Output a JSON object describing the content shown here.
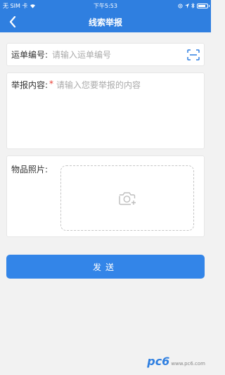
{
  "status_bar": {
    "carrier": "无 SIM 卡",
    "time": "下午5:53",
    "icons": [
      "wifi-icon",
      "lock-rotation-icon",
      "location-icon",
      "bluetooth-icon",
      "battery-icon"
    ]
  },
  "nav": {
    "title": "线索举报",
    "back_icon": "chevron-left-icon"
  },
  "form": {
    "waybill_label": "运单编号:",
    "waybill_placeholder": "请输入运单编号",
    "scan_icon": "scan-icon",
    "content_label": "举报内容:",
    "required_mark": "*",
    "content_placeholder": "请输入您要举报的内容",
    "photo_label": "物品照片:",
    "camera_icon": "camera-add-icon"
  },
  "submit_label": "发送",
  "watermark": {
    "logo": "pc6",
    "url": "www.pc6.com"
  },
  "colors": {
    "accent": "#2f7fe0",
    "button": "#3385e8",
    "required": "#e83a2f"
  }
}
